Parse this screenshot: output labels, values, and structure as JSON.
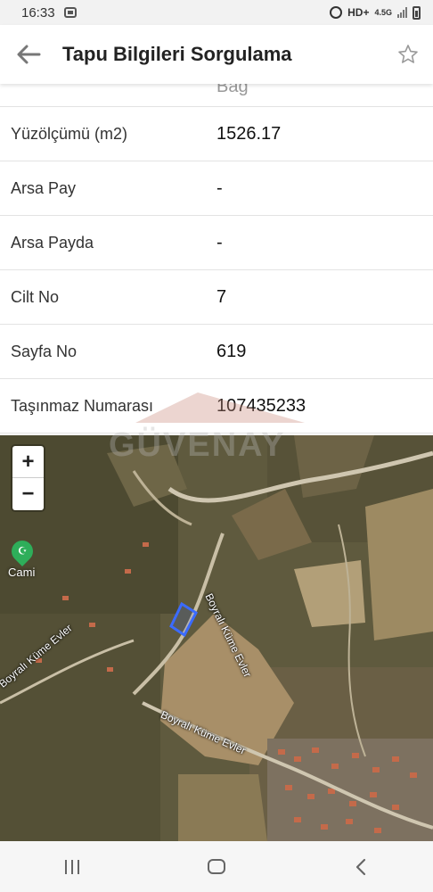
{
  "status_bar": {
    "time": "16:33",
    "network": "HD+",
    "network_type": "4.5G"
  },
  "app_bar": {
    "title": "Tapu Bilgileri Sorgulama",
    "back_icon": "back-arrow-icon",
    "star_icon": "star-outline-icon"
  },
  "partial_row_value": "Bağ",
  "rows": [
    {
      "label": "Yüzölçümü (m2)",
      "value": "1526.17"
    },
    {
      "label": "Arsa Pay",
      "value": "-"
    },
    {
      "label": "Arsa Payda",
      "value": "-"
    },
    {
      "label": "Cilt No",
      "value": "7"
    },
    {
      "label": "Sayfa No",
      "value": "619"
    },
    {
      "label": "Taşınmaz Numarası",
      "value": "107435233"
    }
  ],
  "watermark": {
    "text": "GÜVENAY"
  },
  "map": {
    "zoom_in": "+",
    "zoom_out": "−",
    "poi_label": "Cami",
    "road_labels": [
      "Boyralı Küme Evler",
      "Boyralı Küme Evler",
      "Boyralı Küme Evler"
    ],
    "parcel_color": "#3b6bff"
  },
  "nav_bar": {
    "recent_icon": "recent-apps-icon",
    "home_icon": "home-icon",
    "back_icon": "nav-back-icon"
  }
}
